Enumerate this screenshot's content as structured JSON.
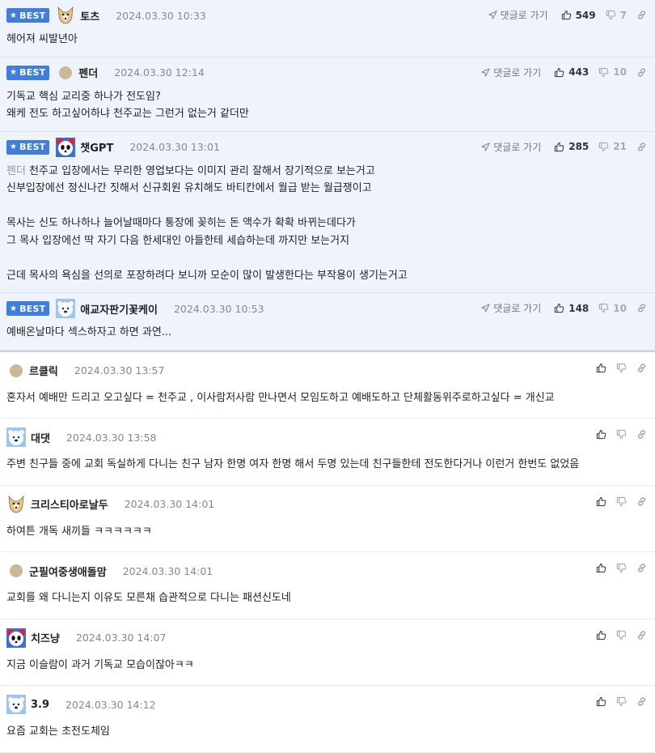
{
  "ui": {
    "best_label": "BEST",
    "go_reply_label": "댓글로 가기"
  },
  "best_comments": [
    {
      "nick": "토츠",
      "date": "2024.03.30 10:33",
      "up": "549",
      "down": "7",
      "avatar": "dog-avatar-icon",
      "text": "헤어져 씨발년아",
      "mention": ""
    },
    {
      "nick": "펜더",
      "date": "2024.03.30 12:14",
      "up": "443",
      "down": "10",
      "avatar": "default-dot-avatar",
      "text": "기독교 핵심 교리중 하나가 전도임?\n왜케 전도 하고싶어하냐 천주교는 그런거 없는거 같더만",
      "mention": ""
    },
    {
      "nick": "챗GPT",
      "date": "2024.03.30 13:01",
      "up": "285",
      "down": "21",
      "avatar": "panda-avatar-icon",
      "mention": "펜더",
      "text": " 천주교 입장에서는 무리한 영업보다는 이미지 관리 잘해서 장기적으로 보는거고\n신부입장에선 정신나간 짓해서 신규회원 유치해도 바티칸에서 월급 받는 월급쟁이고\n\n목사는 신도 하나하나 늘어날때마다 통장에 꽂히는 돈 액수가 확확 바뀌는데다가\n그 목사 입장에선 딱 자기 다음 한세대인 아들한테 세습하는데 까지만 보는거지\n\n근데 목사의 욕심을 선의로 포장하려다 보니까 모순이 많이 발생한다는 부작용이 생기는거고"
    },
    {
      "nick": "애교자판기꽃케이",
      "date": "2024.03.30 10:53",
      "up": "148",
      "down": "10",
      "avatar": "polarbear-avatar-icon",
      "text": "예배온날마다 섹스하자고 하면 과연...",
      "mention": ""
    }
  ],
  "comments": [
    {
      "nick": "르클릭",
      "date": "2024.03.30 13:57",
      "avatar": "default-dot-avatar",
      "text": "혼자서 예배만 드리고 오고싶다 = 천주교 , 이사람저사람 만나면서 모임도하고 예배도하고 단체활동위주로하고싶다 = 개신교"
    },
    {
      "nick": "대댓",
      "date": "2024.03.30 13:58",
      "avatar": "polarbear-avatar-icon",
      "text": "주변 친구들 중에 교회 독실하게 다니는 친구 남자 한명 여자 한명 해서 두명 있는데 친구들한테 전도한다거나 이런거 한번도 없었음"
    },
    {
      "nick": "크리스티아로날두",
      "date": "2024.03.30 14:01",
      "avatar": "dog-avatar-icon",
      "text": "하여튼 개독 새끼들 ㅋㅋㅋㅋㅋㅋ"
    },
    {
      "nick": "군필여중생애돌맘",
      "date": "2024.03.30 14:01",
      "avatar": "default-dot-avatar",
      "text": "교회를 왜 다니는지 이유도 모른채 습관적으로 다니는 패션신도네"
    },
    {
      "nick": "치즈냥",
      "date": "2024.03.30 14:07",
      "avatar": "panda-avatar-icon",
      "text": "지금 이슬람이 과거 기독교 모습이잖아ㅋㅋ"
    },
    {
      "nick": "3.9",
      "date": "2024.03.30 14:12",
      "avatar": "polarbear-avatar-icon",
      "text": "요즘 교회는 초전도체임"
    }
  ],
  "colors": {
    "best_badge": "#3f7de0",
    "best_bg": "#eff4fc"
  }
}
